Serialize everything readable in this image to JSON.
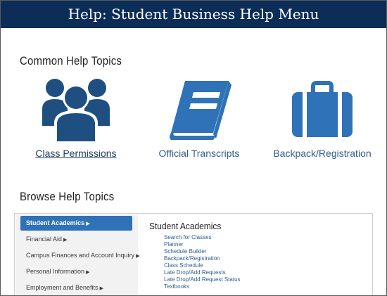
{
  "header": {
    "title": "Help: Student Business Help Menu"
  },
  "common": {
    "title": "Common Help Topics",
    "topics": [
      {
        "label": "Class Permissions",
        "icon": "group-users-icon"
      },
      {
        "label": "Official Transcripts",
        "icon": "book-icon"
      },
      {
        "label": "Backpack/Registration",
        "icon": "briefcase-icon"
      }
    ]
  },
  "browse": {
    "title": "Browse Help Topics",
    "sidebar": [
      "Student Academics",
      "Financial Aid",
      "Campus Finances and Account Inquiry",
      "Personal Information",
      "Employment and Benefits"
    ],
    "content": {
      "title": "Student Academics",
      "links": [
        "Search for Classes",
        "Planner",
        "Schedule Builder",
        "Backpack/Registration",
        "Class Schedule",
        "Late Drop/Add Requests",
        "Late Drop/Add Request Status",
        "Textbooks"
      ]
    }
  },
  "colors": {
    "header_bg": "#0c2d57",
    "icon_dark": "#1f4f80",
    "icon_blue": "#2f72b8",
    "link": "#2f5d8f",
    "active_item": "#2f72b8"
  }
}
